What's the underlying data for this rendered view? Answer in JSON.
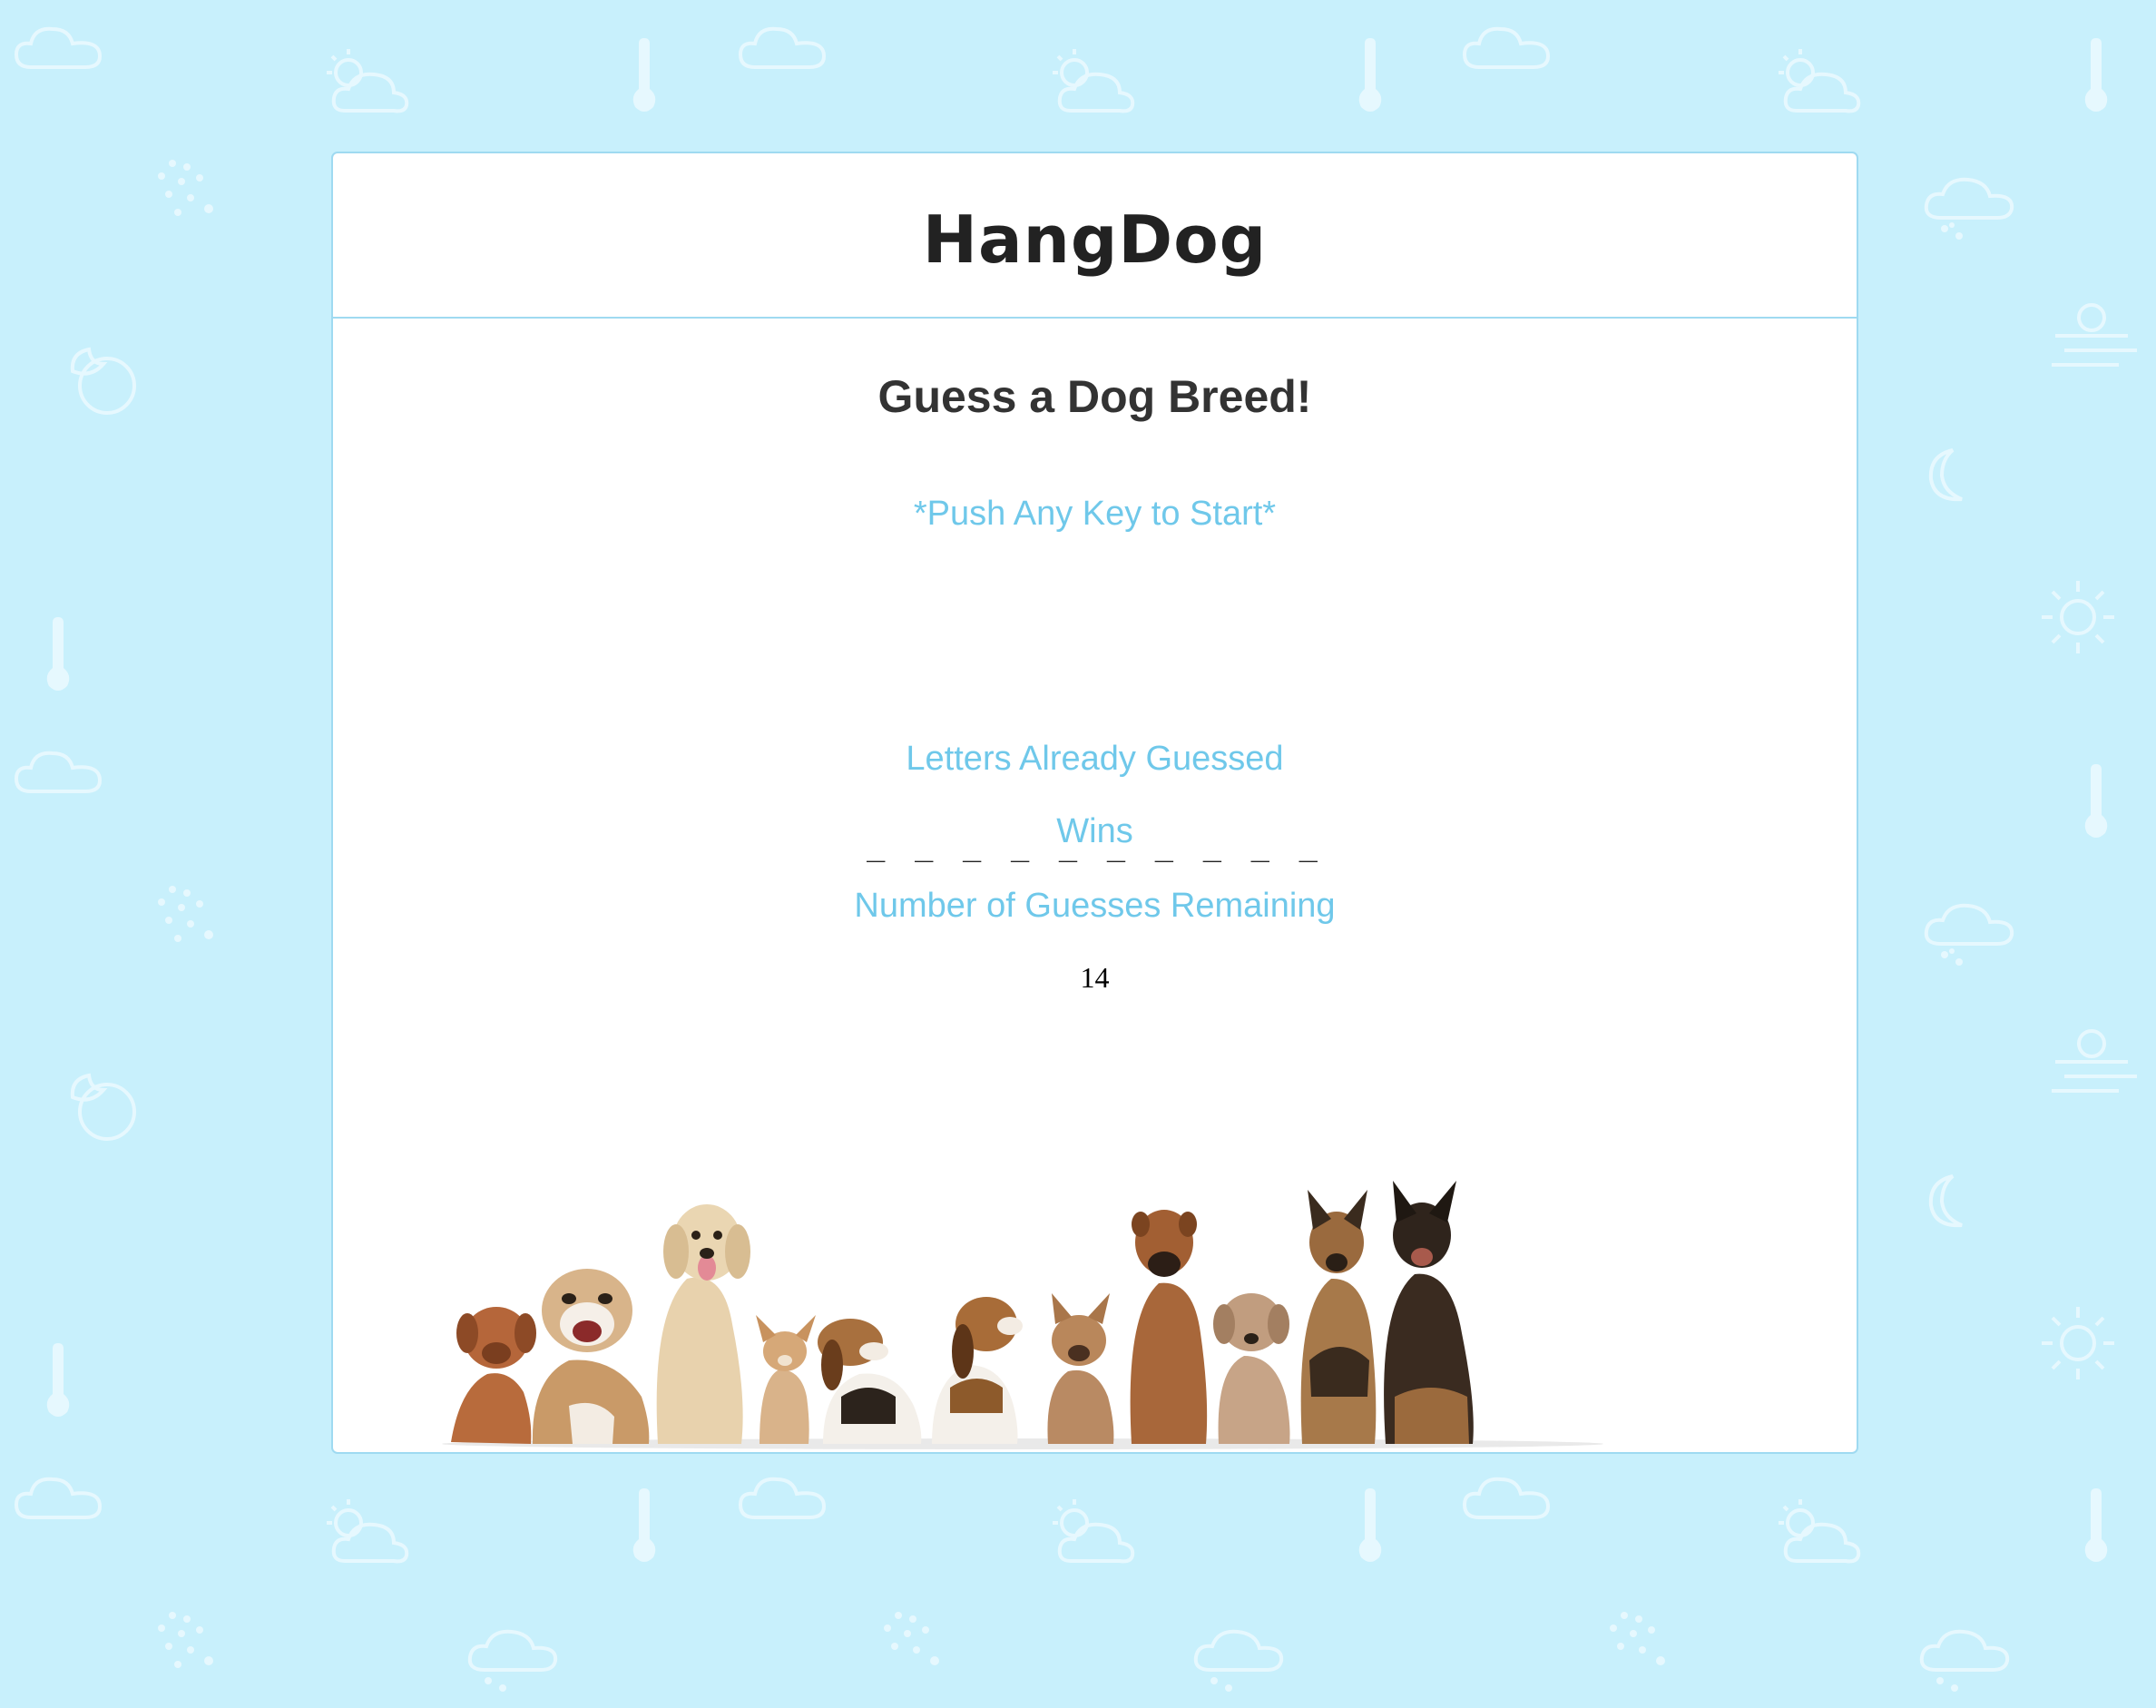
{
  "header": {
    "title": "HangDog"
  },
  "game": {
    "subtitle": "Guess a Dog Breed!",
    "start_prompt": "*Push Any Key to Start*",
    "word_blanks": "_ _ _ _ _ _ _ _ _ _",
    "letters_guessed_label": "Letters Already Guessed",
    "wins_label": "Wins",
    "guesses_remaining_label": "Number of Guesses Remaining",
    "guesses_remaining_value": "14"
  },
  "background": {
    "color": "#c8f0fc",
    "icon_color": "#e6f8fe",
    "icons": [
      "cloud-icon",
      "partly-sunny-icon",
      "thermometer-icon",
      "snow-cloud-icon",
      "night-cloud-icon",
      "windy-icon",
      "moon-icon",
      "sun-icon",
      "dots-icon"
    ]
  },
  "colors": {
    "accent": "#6fc8ea",
    "border": "#9fdaf1",
    "title": "#222222"
  },
  "dogs_image": {
    "description_icon": "dog-lineup-image"
  }
}
